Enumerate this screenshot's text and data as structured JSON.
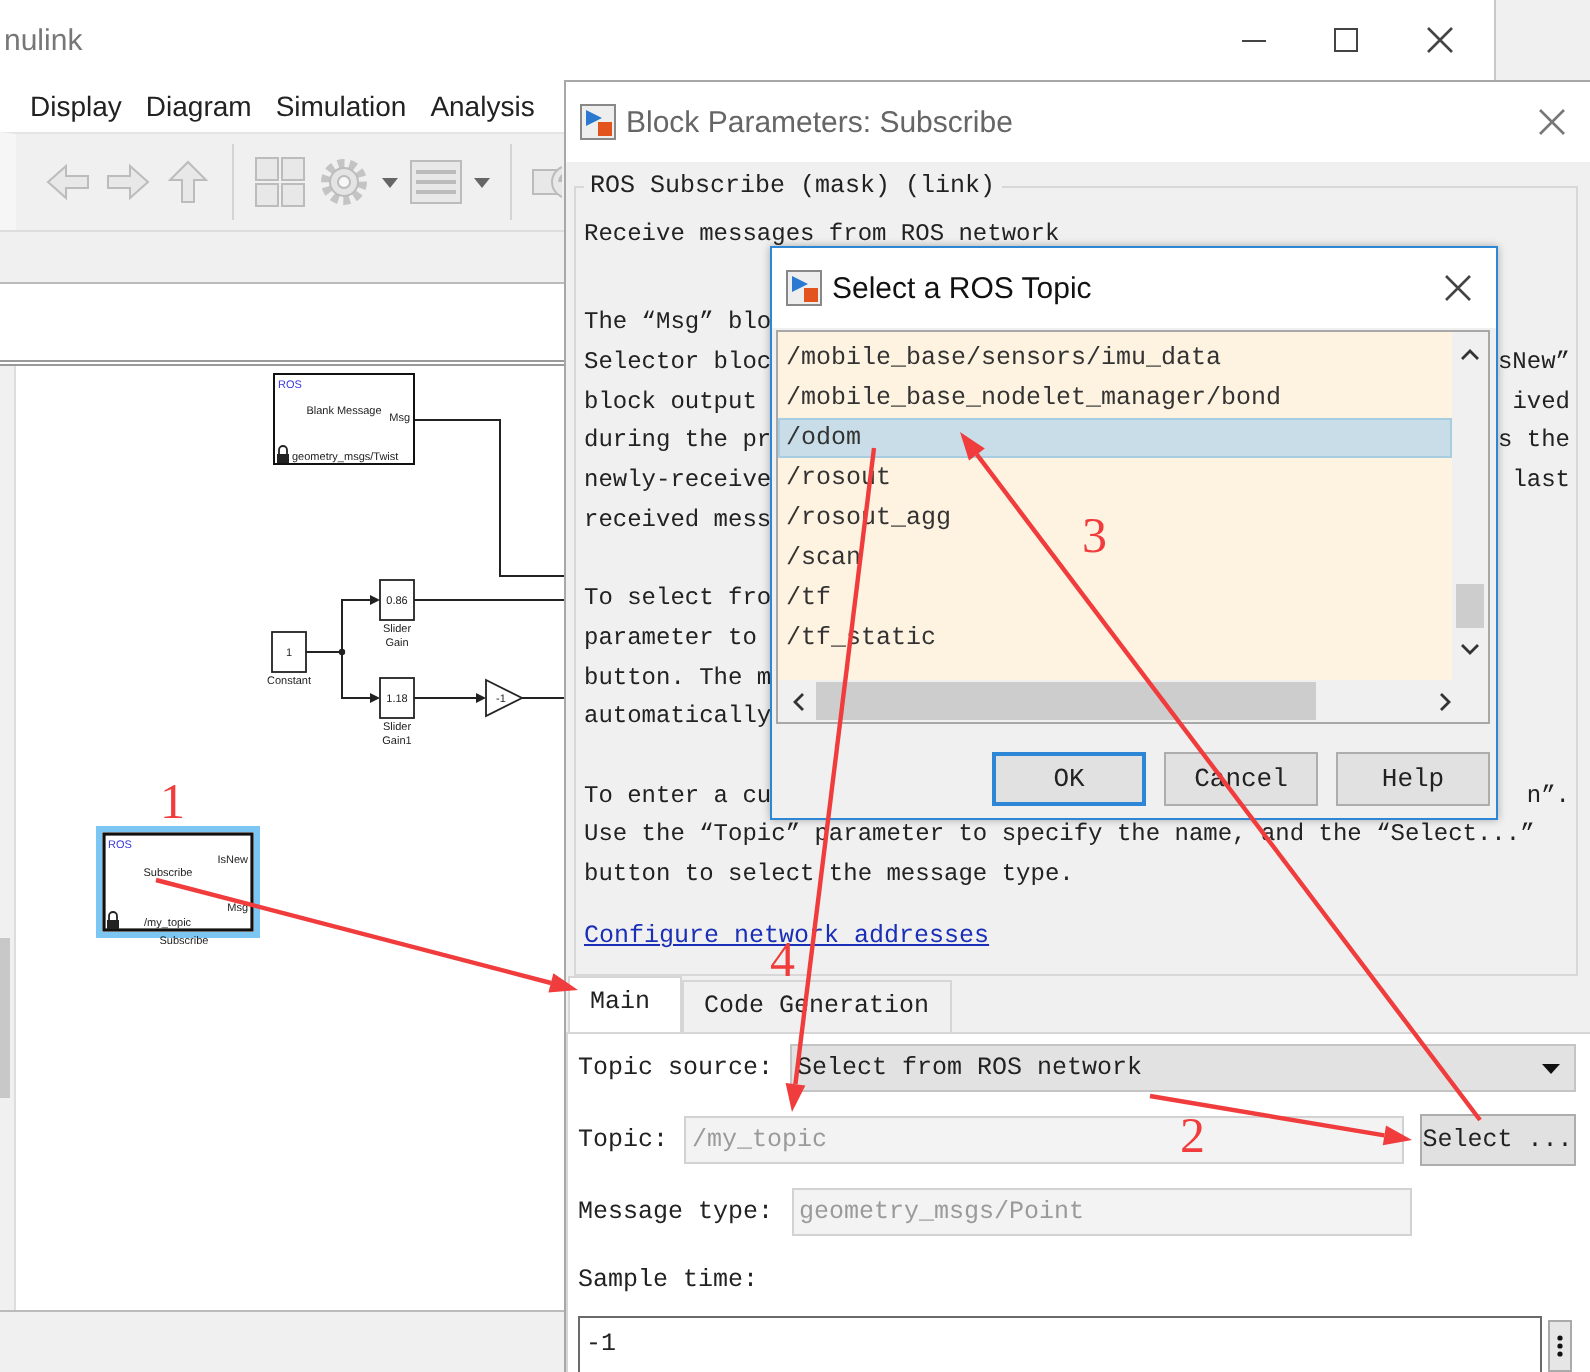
{
  "simulink_window": {
    "title": "nulink",
    "menu": [
      "Display",
      "Diagram",
      "Simulation",
      "Analysis"
    ],
    "diagram": {
      "blocks": [
        {
          "kind": "ros",
          "tag": "ROS",
          "name": "Blank Message",
          "outputs": [
            "Msg"
          ],
          "footer": "geometry_msgs/Twist",
          "selected": false
        },
        {
          "kind": "slider",
          "value": "0.86",
          "caption": [
            "Slider",
            "Gain"
          ]
        },
        {
          "kind": "constant",
          "value": "1",
          "caption": [
            "Constant"
          ]
        },
        {
          "kind": "slider",
          "value": "1.18",
          "caption": [
            "Slider",
            "Gain1"
          ]
        },
        {
          "kind": "gain",
          "value": "-1"
        },
        {
          "kind": "ros",
          "tag": "ROS",
          "name": "Subscribe",
          "outputs": [
            "IsNew",
            "Msg"
          ],
          "footer": "/my_topic",
          "caption": [
            "Subscribe"
          ],
          "selected": true
        }
      ]
    }
  },
  "block_parameters": {
    "title": "Block Parameters: Subscribe",
    "group_title": "ROS Subscribe (mask) (link)",
    "paragraphs": [
      [
        {
          "left": "Receive messages from ROS network"
        }
      ],
      [
        {
          "left": "The “Msg” blo"
        },
        {
          "left": "Selector bloc",
          "right": "sNew”"
        },
        {
          "left": "block output",
          "right": "ived"
        },
        {
          "left": "during the pr",
          "right": "s the"
        },
        {
          "left": "newly-receive",
          "right": "last"
        },
        {
          "left": "received mess"
        }
      ],
      [
        {
          "left": "To select fro"
        },
        {
          "left": "parameter to"
        },
        {
          "left": "button. The m"
        },
        {
          "left": "automatically"
        }
      ],
      [
        {
          "left": "To enter a cu",
          "right": "n”."
        },
        {
          "left": "Use the “Topic” parameter to specify the name, and the “Select...”"
        },
        {
          "left": "button to select the message type."
        }
      ]
    ],
    "link": "Configure network addresses",
    "tabs": [
      {
        "label": "Main",
        "selected": true
      },
      {
        "label": "Code Generation",
        "selected": false
      }
    ],
    "topic_source": {
      "label": "Topic source:",
      "value": "Select from ROS network"
    },
    "topic": {
      "label": "Topic:",
      "value": "/my_topic",
      "disabled": true
    },
    "select_button": "Select ...",
    "message_type": {
      "label": "Message type:",
      "value": "geometry_msgs/Point",
      "disabled": true
    },
    "sample_time": {
      "label": "Sample time:",
      "value": "-1",
      "disabled": false
    }
  },
  "topic_dialog": {
    "title": "Select a ROS Topic",
    "topics": [
      {
        "name": "/mobile_base/sensors/imu_data",
        "selected": false
      },
      {
        "name": "/mobile_base_nodelet_manager/bond",
        "selected": false
      },
      {
        "name": "/odom",
        "selected": true
      },
      {
        "name": "/rosout",
        "selected": false
      },
      {
        "name": "/rosout_agg",
        "selected": false
      },
      {
        "name": "/scan",
        "selected": false
      },
      {
        "name": "/tf",
        "selected": false
      },
      {
        "name": "/tf_static",
        "selected": false
      }
    ],
    "buttons": [
      {
        "label": "OK",
        "default": true
      },
      {
        "label": "Cancel",
        "default": false
      },
      {
        "label": "Help",
        "default": false
      }
    ]
  },
  "annotations": [
    {
      "number": "1"
    },
    {
      "number": "2"
    },
    {
      "number": "3"
    },
    {
      "number": "4"
    }
  ]
}
